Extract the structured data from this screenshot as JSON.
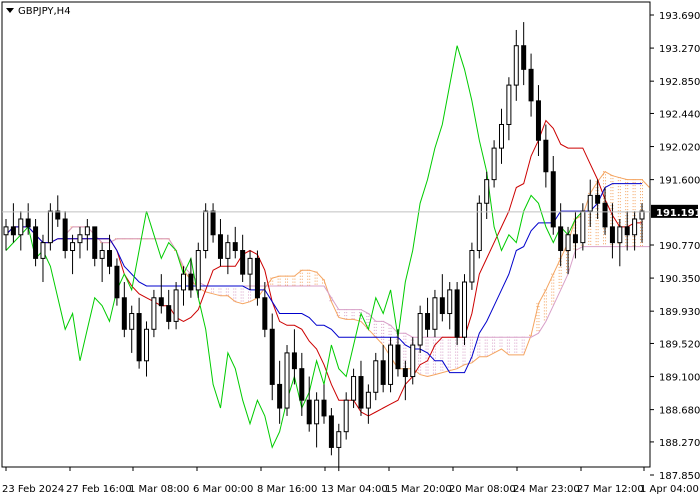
{
  "window": {
    "symbol_label": "GBPJPY,H4"
  },
  "chart_data": {
    "type": "candlestick",
    "symbol": "GBPJPY",
    "timeframe": "H4",
    "current_price": "191.191",
    "ylim": [
      187.85,
      193.8
    ],
    "y_ticks": [
      "193.690",
      "193.270",
      "192.850",
      "192.440",
      "192.020",
      "191.600",
      "191.191",
      "190.770",
      "190.350",
      "189.930",
      "189.520",
      "189.100",
      "188.680",
      "188.270",
      "187.850"
    ],
    "x_ticks": [
      "23 Feb 2024",
      "27 Feb 16:00",
      "1 Mar 08:00",
      "6 Mar 00:00",
      "8 Mar 16:00",
      "13 Mar 04:00",
      "15 Mar 20:00",
      "20 Mar 08:00",
      "24 Mar 23:00",
      "27 Mar 12:00",
      "1 Apr 04:00"
    ],
    "candles_ohlc": [
      [
        190.9,
        191.1,
        190.7,
        191.0
      ],
      [
        191.0,
        191.3,
        190.8,
        190.9
      ],
      [
        190.9,
        191.2,
        190.7,
        191.1
      ],
      [
        191.1,
        191.3,
        190.9,
        191.0
      ],
      [
        191.0,
        191.1,
        190.5,
        190.6
      ],
      [
        190.6,
        190.9,
        190.3,
        190.8
      ],
      [
        190.8,
        191.3,
        190.7,
        191.2
      ],
      [
        191.2,
        191.4,
        191.0,
        191.1
      ],
      [
        191.1,
        191.2,
        190.6,
        190.7
      ],
      [
        190.7,
        190.9,
        190.4,
        190.8
      ],
      [
        190.8,
        191.0,
        190.6,
        190.9
      ],
      [
        190.9,
        191.1,
        190.7,
        191.0
      ],
      [
        191.0,
        191.0,
        190.5,
        190.6
      ],
      [
        190.6,
        190.8,
        190.3,
        190.7
      ],
      [
        190.7,
        190.9,
        190.4,
        190.5
      ],
      [
        190.5,
        190.6,
        190.0,
        190.1
      ],
      [
        190.1,
        190.3,
        189.6,
        189.7
      ],
      [
        189.7,
        190.0,
        189.4,
        189.9
      ],
      [
        189.9,
        190.1,
        189.2,
        189.3
      ],
      [
        189.3,
        189.8,
        189.1,
        189.7
      ],
      [
        189.7,
        190.2,
        189.6,
        190.1
      ],
      [
        190.1,
        190.4,
        189.9,
        190.0
      ],
      [
        190.0,
        190.2,
        189.7,
        189.8
      ],
      [
        189.8,
        190.3,
        189.7,
        190.2
      ],
      [
        190.2,
        190.5,
        190.0,
        190.4
      ],
      [
        190.4,
        190.6,
        190.1,
        190.2
      ],
      [
        190.2,
        190.8,
        190.1,
        190.7
      ],
      [
        190.7,
        191.3,
        190.6,
        191.2
      ],
      [
        191.2,
        191.3,
        190.8,
        190.9
      ],
      [
        190.9,
        191.1,
        190.5,
        190.6
      ],
      [
        190.6,
        190.9,
        190.4,
        190.8
      ],
      [
        190.8,
        191.0,
        190.6,
        190.7
      ],
      [
        190.7,
        190.9,
        190.3,
        190.4
      ],
      [
        190.4,
        190.7,
        190.2,
        190.6
      ],
      [
        190.6,
        190.7,
        190.0,
        190.1
      ],
      [
        190.1,
        190.3,
        189.6,
        189.7
      ],
      [
        189.7,
        189.9,
        188.8,
        189.0
      ],
      [
        189.0,
        189.3,
        188.5,
        188.7
      ],
      [
        188.7,
        189.5,
        188.6,
        189.4
      ],
      [
        189.4,
        189.7,
        189.0,
        189.2
      ],
      [
        189.2,
        189.4,
        188.6,
        188.8
      ],
      [
        188.8,
        189.1,
        188.4,
        188.5
      ],
      [
        188.5,
        188.9,
        188.2,
        188.8
      ],
      [
        188.8,
        189.0,
        188.5,
        188.6
      ],
      [
        188.6,
        188.7,
        188.1,
        188.2
      ],
      [
        188.2,
        188.5,
        187.9,
        188.4
      ],
      [
        188.4,
        188.9,
        188.3,
        188.8
      ],
      [
        188.8,
        189.2,
        188.7,
        189.1
      ],
      [
        189.1,
        189.3,
        188.6,
        188.7
      ],
      [
        188.7,
        189.0,
        188.5,
        188.9
      ],
      [
        188.9,
        189.4,
        188.8,
        189.3
      ],
      [
        189.3,
        189.5,
        188.9,
        189.0
      ],
      [
        189.0,
        189.6,
        188.9,
        189.5
      ],
      [
        189.5,
        189.7,
        189.1,
        189.2
      ],
      [
        189.2,
        189.3,
        188.8,
        189.1
      ],
      [
        189.1,
        189.6,
        189.0,
        189.5
      ],
      [
        189.5,
        190.0,
        189.4,
        189.9
      ],
      [
        189.9,
        190.1,
        189.6,
        189.7
      ],
      [
        189.7,
        190.2,
        189.6,
        190.1
      ],
      [
        190.1,
        190.4,
        189.8,
        189.9
      ],
      [
        189.9,
        190.3,
        189.7,
        190.2
      ],
      [
        190.2,
        190.3,
        189.5,
        189.6
      ],
      [
        189.6,
        190.4,
        189.5,
        190.3
      ],
      [
        190.3,
        190.8,
        190.2,
        190.7
      ],
      [
        190.7,
        191.4,
        190.6,
        191.3
      ],
      [
        191.3,
        191.7,
        191.1,
        191.6
      ],
      [
        191.6,
        192.1,
        191.5,
        192.0
      ],
      [
        192.0,
        192.5,
        191.8,
        192.3
      ],
      [
        192.3,
        192.9,
        192.1,
        192.8
      ],
      [
        192.8,
        193.5,
        192.6,
        193.3
      ],
      [
        193.3,
        193.6,
        192.8,
        193.0
      ],
      [
        193.0,
        193.2,
        192.4,
        192.6
      ],
      [
        192.6,
        192.8,
        191.9,
        192.1
      ],
      [
        192.1,
        192.3,
        191.5,
        191.7
      ],
      [
        191.7,
        191.9,
        190.9,
        191.0
      ],
      [
        191.0,
        191.3,
        190.5,
        190.7
      ],
      [
        190.7,
        191.0,
        190.4,
        190.9
      ],
      [
        190.9,
        191.2,
        190.6,
        190.8
      ],
      [
        190.8,
        191.3,
        190.7,
        191.2
      ],
      [
        191.2,
        191.6,
        191.0,
        191.4
      ],
      [
        191.4,
        191.6,
        191.1,
        191.3
      ],
      [
        191.3,
        191.5,
        190.9,
        191.0
      ],
      [
        191.0,
        191.3,
        190.6,
        190.8
      ],
      [
        190.8,
        191.1,
        190.5,
        191.0
      ],
      [
        191.0,
        191.2,
        190.7,
        190.9
      ],
      [
        190.9,
        191.2,
        190.7,
        191.1
      ],
      [
        191.1,
        191.3,
        190.8,
        191.2
      ]
    ],
    "lines": [
      {
        "name": "tenkan",
        "color": "#cc0000"
      },
      {
        "name": "kijun",
        "color": "#0000cc"
      },
      {
        "name": "chikou",
        "color": "#00cc00"
      },
      {
        "name": "senkou_a",
        "color": "#f4a460"
      },
      {
        "name": "senkou_b",
        "color": "#d8a0c8"
      }
    ]
  }
}
